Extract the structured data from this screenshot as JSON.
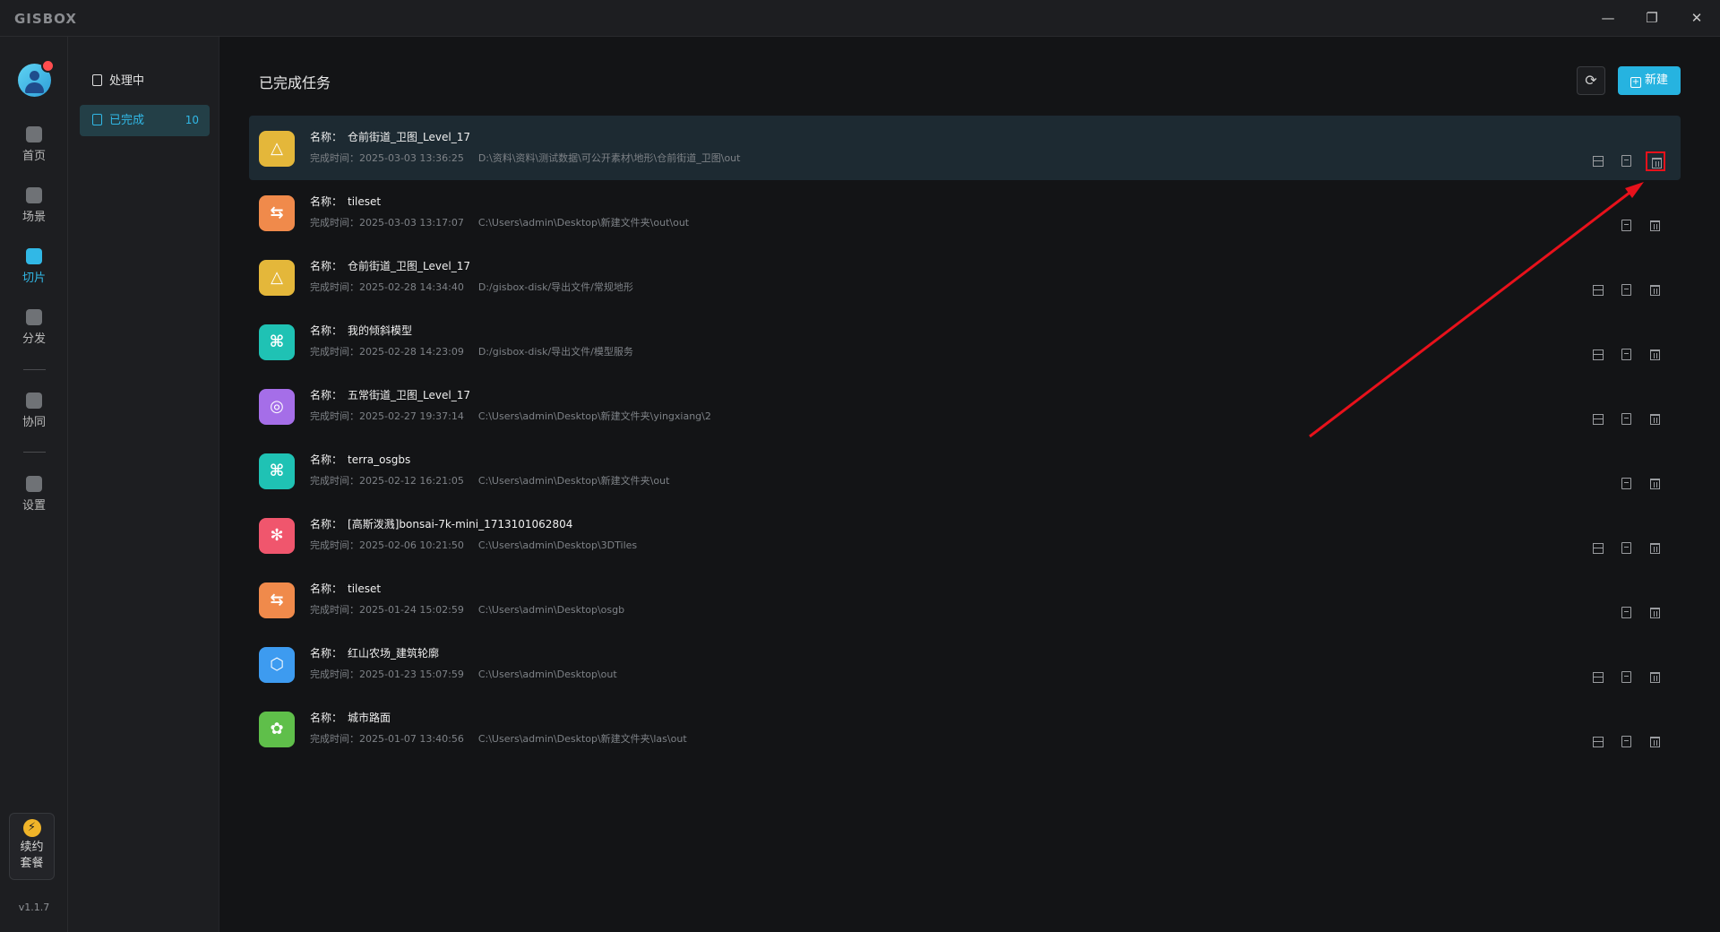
{
  "app": {
    "logo": "GISBOX",
    "minimize": "—",
    "restore": "❐",
    "close": "✕"
  },
  "rail": {
    "items": [
      {
        "label": "首页",
        "icon": "home-icon"
      },
      {
        "label": "场景",
        "icon": "cube-icon"
      },
      {
        "label": "切片",
        "icon": "slice-icon",
        "active": true
      },
      {
        "label": "分发",
        "icon": "publish-icon"
      },
      {
        "label": "协同",
        "icon": "lock-icon"
      },
      {
        "label": "设置",
        "icon": "gear-icon"
      }
    ],
    "renew_line1": "续约",
    "renew_line2": "套餐",
    "version": "v1.1.7"
  },
  "subnav": {
    "processing": "处理中",
    "completed": "已完成",
    "completed_count": "10"
  },
  "main": {
    "title": "已完成任务",
    "new_label": "新建",
    "name_prefix": "名称：",
    "time_prefix": "完成时间：",
    "tasks": [
      {
        "name": "仓前街道_卫图_Level_17",
        "time": "2025-03-03 13:36:25",
        "path": "D:\\资料\\资料\\测试数据\\可公开素材\\地形\\仓前街道_卫图\\out",
        "color": "#e4b73a",
        "glyph": "△",
        "has_layout": true
      },
      {
        "name": "tileset",
        "time": "2025-03-03 13:17:07",
        "path": "C:\\Users\\admin\\Desktop\\新建文件夹\\out\\out",
        "color": "#f08a4b",
        "glyph": "⇆",
        "has_layout": false
      },
      {
        "name": "仓前街道_卫图_Level_17",
        "time": "2025-02-28 14:34:40",
        "path": "D:/gisbox-disk/导出文件/常规地形",
        "color": "#e4b73a",
        "glyph": "△",
        "has_layout": true
      },
      {
        "name": "我的倾斜模型",
        "time": "2025-02-28 14:23:09",
        "path": "D:/gisbox-disk/导出文件/模型服务",
        "color": "#1fc2b4",
        "glyph": "⌘",
        "has_layout": true
      },
      {
        "name": "五常街道_卫图_Level_17",
        "time": "2025-02-27 19:37:14",
        "path": "C:\\Users\\admin\\Desktop\\新建文件夹\\yingxiang\\2",
        "color": "#a56ee8",
        "glyph": "◎",
        "has_layout": true
      },
      {
        "name": "terra_osgbs",
        "time": "2025-02-12 16:21:05",
        "path": "C:\\Users\\admin\\Desktop\\新建文件夹\\out",
        "color": "#1fc2b4",
        "glyph": "⌘",
        "has_layout": false
      },
      {
        "name": "[高斯泼溅]bonsai-7k-mini_1713101062804",
        "time": "2025-02-06 10:21:50",
        "path": "C:\\Users\\admin\\Desktop\\3DTiles",
        "color": "#f0566d",
        "glyph": "✻",
        "has_layout": true
      },
      {
        "name": "tileset",
        "time": "2025-01-24 15:02:59",
        "path": "C:\\Users\\admin\\Desktop\\osgb",
        "color": "#f08a4b",
        "glyph": "⇆",
        "has_layout": false
      },
      {
        "name": "红山农场_建筑轮廓",
        "time": "2025-01-23 15:07:59",
        "path": "C:\\Users\\admin\\Desktop\\out",
        "color": "#3d9bf0",
        "glyph": "⬡",
        "has_layout": true
      },
      {
        "name": "城市路面",
        "time": "2025-01-07 13:40:56",
        "path": "C:\\Users\\admin\\Desktop\\新建文件夹\\las\\out",
        "color": "#5fbf4a",
        "glyph": "✿",
        "has_layout": true
      }
    ]
  },
  "colors": {
    "accent": "#31b8e6",
    "annotation": "#e8111b"
  }
}
